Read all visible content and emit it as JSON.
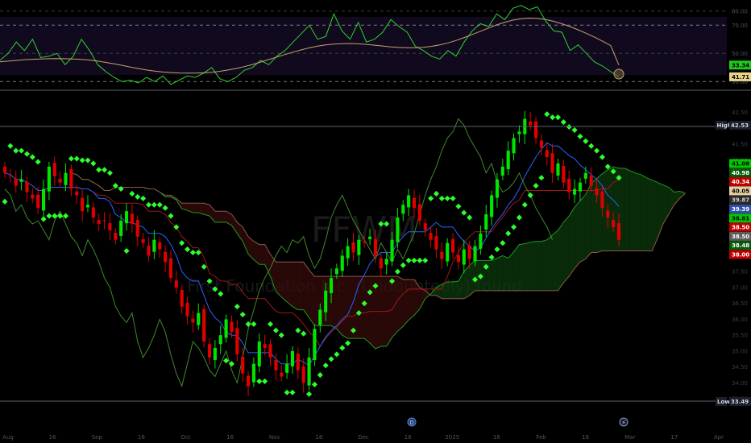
{
  "colors": {
    "background": "#000000",
    "up": "#00e600",
    "down": "#e00000",
    "psar": "#2dff2d",
    "tenkan": "#2962ff",
    "kijun": "#a01818",
    "chikou": "#3f8a2a",
    "span_a": "#1f9a1f",
    "span_b": "#8a5a4a",
    "cloud_bull": "#0d3d0d",
    "cloud_bear": "#3a0c0c",
    "rsi": "#2bd42b",
    "rsi_ma": "#c8a070",
    "range_line": "#5d606b"
  },
  "watermark": {
    "symbol": "FFWM",
    "description": "First Foundation Inc. (Undoubtedly) found"
  },
  "chart_data": [
    {
      "type": "line",
      "name": "rsi-pane",
      "ylim": [
        25,
        85
      ],
      "levels": [
        80,
        70,
        50,
        30
      ],
      "level_labels": [
        "80.00",
        "70.00",
        "50.00",
        "30.00"
      ],
      "series": [
        {
          "name": "",
          "values": [
            45,
            50,
            58,
            52,
            60,
            47,
            48,
            50,
            42,
            48,
            60,
            52,
            42,
            37,
            33,
            30,
            31,
            29,
            33,
            30,
            34,
            28,
            31,
            34,
            33,
            36,
            40,
            32,
            30,
            33,
            38,
            40,
            45,
            42,
            48,
            52,
            58,
            64,
            70,
            60,
            62,
            78,
            66,
            60,
            72,
            58,
            60,
            65,
            74,
            69,
            65,
            55,
            52,
            48,
            46,
            52,
            48,
            58,
            66,
            71,
            69,
            78,
            74,
            82,
            84,
            81,
            83,
            73,
            66,
            65,
            52,
            56,
            50,
            44,
            41,
            37,
            33.34
          ]
        },
        {
          "name": "",
          "values": [
            44,
            44.5,
            45,
            45.5,
            45.8,
            46,
            46.2,
            46.3,
            46.2,
            46,
            45.7,
            45.2,
            44.5,
            43.6,
            42.6,
            41.5,
            40.3,
            39.2,
            38.2,
            37.4,
            36.8,
            36.4,
            36.1,
            36,
            36,
            36.2,
            36.6,
            37.3,
            38.2,
            39.3,
            40.6,
            42.1,
            43.8,
            45.6,
            47.4,
            49.2,
            50.9,
            52.5,
            53.9,
            55.1,
            56,
            56.6,
            56.9,
            57,
            56.8,
            56.4,
            55.8,
            55.2,
            54.6,
            54.2,
            54,
            54,
            54.3,
            55,
            56,
            57.4,
            59.1,
            61.2,
            63.4,
            65.7,
            68,
            70.2,
            72.1,
            73.6,
            74.6,
            75,
            74.8,
            74,
            72.7,
            71,
            69,
            66.7,
            64.2,
            61.5,
            58.6,
            55.5,
            41.71
          ]
        }
      ],
      "last_labels": [
        "41.71",
        "33.34"
      ]
    },
    {
      "type": "candlestick",
      "name": "price-pane",
      "ylim": [
        33.2,
        43.0
      ],
      "price_ticks": [
        42.5,
        41.5,
        41,
        40.5,
        40,
        39.5,
        39,
        38.5,
        38,
        37.5,
        37,
        36.5,
        36,
        35.5,
        35,
        34.5,
        34,
        33.5
      ],
      "high": {
        "label": "High",
        "value": "42.53"
      },
      "low": {
        "label": "Low",
        "value": "33.49"
      },
      "close": [
        40.6,
        40.5,
        40.2,
        40.4,
        40.0,
        39.8,
        39.5,
        40.1,
        40.8,
        40.5,
        40.3,
        40.6,
        40.1,
        39.9,
        39.4,
        39.6,
        39.2,
        39.0,
        39.1,
        38.8,
        38.5,
        39.1,
        39.4,
        39.0,
        38.6,
        38.4,
        38.0,
        38.5,
        38.2,
        37.8,
        37.3,
        37.0,
        36.4,
        36.1,
        35.9,
        36.2,
        35.3,
        34.8,
        35.1,
        35.5,
        36.0,
        35.6,
        34.9,
        34.3,
        33.9,
        34.6,
        35.3,
        35.1,
        34.8,
        34.4,
        34.2,
        34.6,
        35.0,
        34.4,
        34.0,
        34.8,
        35.7,
        36.3,
        36.9,
        37.3,
        37.6,
        38.0,
        38.3,
        38.1,
        38.5,
        38.4,
        38.6,
        38.0,
        37.6,
        37.9,
        38.5,
        39.2,
        39.6,
        39.9,
        39.5,
        39.1,
        38.8,
        38.5,
        38.2,
        37.9,
        38.4,
        38.1,
        37.8,
        38.2,
        37.9,
        38.3,
        38.7,
        39.3,
        39.9,
        40.4,
        40.8,
        41.3,
        41.7,
        41.9,
        42.3,
        42.1,
        41.7,
        41.4,
        41.1,
        40.6,
        40.9,
        40.3,
        40.0,
        40.1,
        40.3,
        40.6,
        40.2,
        39.9,
        39.5,
        39.2,
        38.9,
        38.5
      ]
    }
  ],
  "right_axis_tags": [
    {
      "name": "tag-41-08",
      "text": "41.08",
      "color": "#00c800",
      "text_color": "#000000"
    },
    {
      "name": "tag-40-98",
      "text": "40.98",
      "color": "#0b5a0b",
      "text_color": "#ffffff"
    },
    {
      "name": "tag-40-34",
      "text": "40.34",
      "color": "#c00000",
      "text_color": "#ffffff"
    },
    {
      "name": "tag-40-05",
      "text": "40.05",
      "color": "#e8cfa2",
      "text_color": "#000000"
    },
    {
      "name": "tag-39-87",
      "text": "39.87",
      "color": "#2a2a2a",
      "text_color": "#d0d0d0"
    },
    {
      "name": "tag-39-39",
      "text": "39.39",
      "color": "#2f4fa8",
      "text_color": "#ffffff"
    },
    {
      "name": "tag-38-81",
      "text": "38.81",
      "color": "#00c800",
      "text_color": "#000000"
    },
    {
      "name": "tag-38-50",
      "text": "38.50",
      "color": "#c00000",
      "text_color": "#ffffff"
    },
    {
      "name": "tag-38-50b",
      "text": "38.50",
      "color": "#5a5a5a",
      "text_color": "#ffffff"
    },
    {
      "name": "tag-38-48",
      "text": "38.48",
      "color": "#0b5a0b",
      "text_color": "#ffffff"
    },
    {
      "name": "tag-38-00",
      "text": "38.00",
      "color": "#c00000",
      "text_color": "#ffffff"
    }
  ],
  "time_axis": [
    "Aug",
    "16",
    "Sep",
    "16",
    "Oct",
    "16",
    "Nov",
    "18",
    "Dec",
    "16",
    "2025",
    "16",
    "Feb",
    "18",
    "Mar",
    "17",
    "Apr"
  ],
  "event_markers": [
    {
      "name": "dividend-marker",
      "text": "D"
    },
    {
      "name": "earnings-marker",
      "text": "⚡"
    }
  ]
}
